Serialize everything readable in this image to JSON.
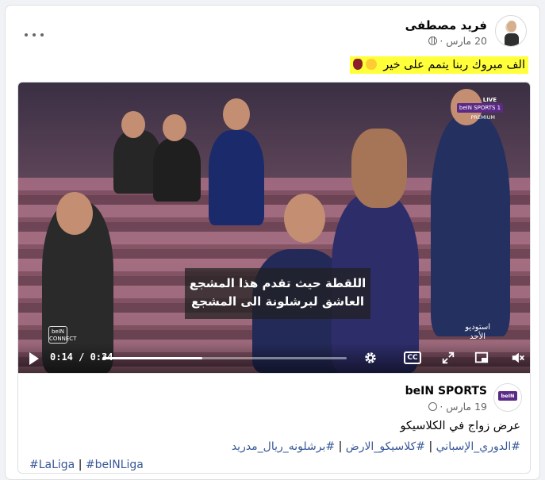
{
  "post": {
    "author": "فريد مصطفى",
    "date": "20 مارس ·",
    "caption": "الف مبروك ربنا يتمم على خير",
    "highlight_color": "#ffff3a"
  },
  "shared": {
    "page_name": "beIN SPORTS",
    "date": "19 مارس ·",
    "text": "عرض زواج في الكلاسيكو",
    "tags_arabic": [
      "#الدوري_الإسباني",
      "#كلاسيكو_الارض",
      "#برشلونه_ريال_مدريد"
    ],
    "tags_latin": [
      "#LaLiga",
      "#beINLiga"
    ],
    "separator": "|"
  },
  "video": {
    "subtitle_line1": "اللقطة حيث تقدم هذا المشجع",
    "subtitle_line2": "العاشق لبرشلونة الى المشجع",
    "time": "0:14 / 0:34",
    "progress": 0.41,
    "channel_live": "LIVE",
    "channel_name": "beIN SPORTS 1",
    "channel_tier": "PREMIUM",
    "studio_line1": "استوديو",
    "studio_line2": "الأحد",
    "connect_label": "beIN CONNECT",
    "cc_label": "CC"
  },
  "icons": {
    "more": "more-horizontal-icon",
    "globe": "globe-icon",
    "play": "play-icon",
    "settings": "gear-icon",
    "captions": "captions-icon",
    "fullscreen": "expand-icon",
    "pip": "picture-in-picture-icon",
    "volume": "volume-muted-icon"
  },
  "colors": {
    "link": "#385898",
    "brand": "#5b2a86"
  }
}
